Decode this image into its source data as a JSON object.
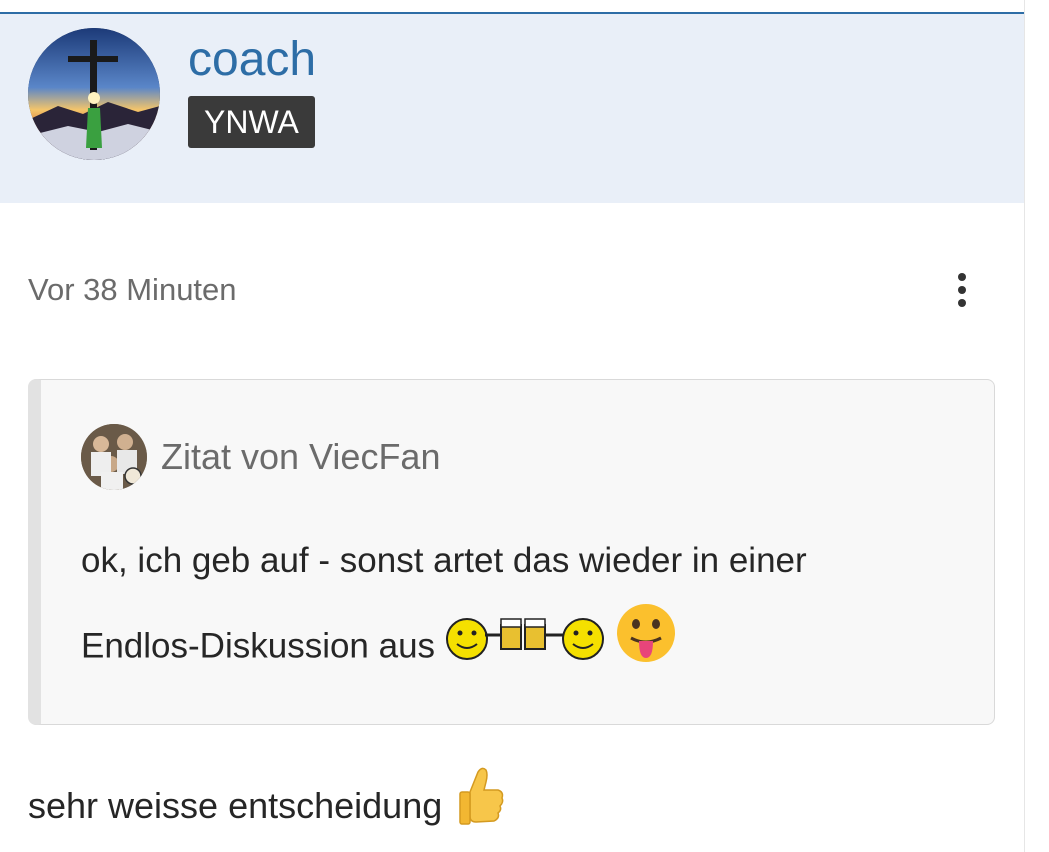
{
  "post": {
    "author": "coach",
    "badge": "YNWA",
    "timestamp": "Vor 38 Minuten",
    "body": "sehr weisse entscheidung",
    "body_emoji_icon": "thumbs-up-icon"
  },
  "quote": {
    "author_label": "Zitat von ViecFan",
    "text_line1": "ok, ich geb auf - sonst artet das wieder in einer",
    "text_line2": "Endlos-Diskussion aus",
    "emoji_icons": [
      "cheers-smileys-icon",
      "tongue-out-icon"
    ]
  },
  "colors": {
    "accent": "#2d6da6",
    "header_bg": "#e9eff8",
    "badge_bg": "#3a3a3a",
    "text": "#262626",
    "muted": "#6b6b6b"
  }
}
